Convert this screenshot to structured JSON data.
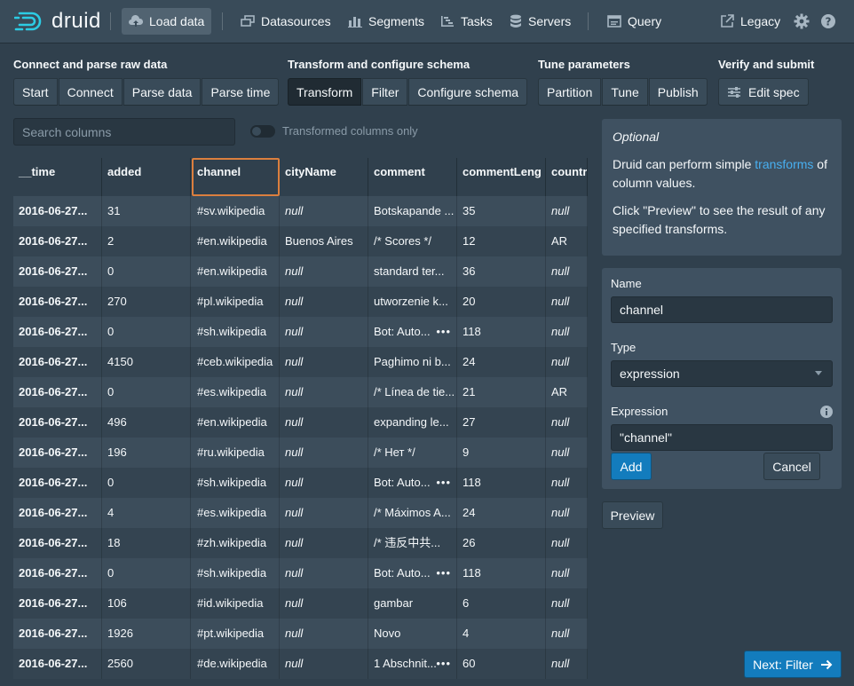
{
  "colors": {
    "accent": "#137cbd",
    "link": "#48aff0",
    "selected_outline": "#db7f3e"
  },
  "header": {
    "logo_text": "druid",
    "nav": [
      {
        "label": "Load data",
        "icon": "cloud-upload-icon"
      },
      {
        "label": "Datasources",
        "icon": "multi-select-icon"
      },
      {
        "label": "Segments",
        "icon": "stacked-chart-icon"
      },
      {
        "label": "Tasks",
        "icon": "gantt-chart-icon"
      },
      {
        "label": "Servers",
        "icon": "database-icon"
      },
      {
        "label": "Query",
        "icon": "application-icon"
      }
    ],
    "legacy_label": "Legacy"
  },
  "steps": [
    {
      "title": "Connect and parse raw data",
      "buttons": [
        "Start",
        "Connect",
        "Parse data",
        "Parse time"
      ]
    },
    {
      "title": "Transform and configure schema",
      "buttons": [
        "Transform",
        "Filter",
        "Configure schema"
      ],
      "active": "Transform"
    },
    {
      "title": "Tune parameters",
      "buttons": [
        "Partition",
        "Tune",
        "Publish"
      ]
    },
    {
      "title": "Verify and submit",
      "buttons": [
        "Edit spec"
      ]
    }
  ],
  "search": {
    "placeholder": "Search columns"
  },
  "toggle": {
    "label": "Transformed columns only"
  },
  "table": {
    "columns": [
      "__time",
      "added",
      "channel",
      "cityName",
      "comment",
      "commentLeng",
      "countr"
    ],
    "selected_column": "channel",
    "rows": [
      [
        "2016-06-27...",
        "31",
        "#sv.wikipedia",
        "null",
        "Botskapande ...",
        "35",
        "null"
      ],
      [
        "2016-06-27...",
        "2",
        "#en.wikipedia",
        "Buenos Aires",
        "/* Scores */",
        "12",
        "AR"
      ],
      [
        "2016-06-27...",
        "0",
        "#en.wikipedia",
        "null",
        "standard ter...",
        "36",
        "null"
      ],
      [
        "2016-06-27...",
        "270",
        "#pl.wikipedia",
        "null",
        "utworzenie k...",
        "20",
        "null"
      ],
      [
        "2016-06-27...",
        "0",
        "#sh.wikipedia",
        "null",
        "Bot: Auto...",
        "118",
        "null"
      ],
      [
        "2016-06-27...",
        "4150",
        "#ceb.wikipedia",
        "null",
        "Paghimo ni b...",
        "24",
        "null"
      ],
      [
        "2016-06-27...",
        "0",
        "#es.wikipedia",
        "null",
        "/* Línea de tie...",
        "21",
        "AR"
      ],
      [
        "2016-06-27...",
        "496",
        "#en.wikipedia",
        "null",
        "expanding le...",
        "27",
        "null"
      ],
      [
        "2016-06-27...",
        "196",
        "#ru.wikipedia",
        "null",
        "/* Нет */",
        "9",
        "null"
      ],
      [
        "2016-06-27...",
        "0",
        "#sh.wikipedia",
        "null",
        "Bot: Auto...",
        "118",
        "null"
      ],
      [
        "2016-06-27...",
        "4",
        "#es.wikipedia",
        "null",
        "/* Máximos A...",
        "24",
        "null"
      ],
      [
        "2016-06-27...",
        "18",
        "#zh.wikipedia",
        "null",
        "/* 违反中共...",
        "26",
        "null"
      ],
      [
        "2016-06-27...",
        "0",
        "#sh.wikipedia",
        "null",
        "Bot: Auto...",
        "118",
        "null"
      ],
      [
        "2016-06-27...",
        "106",
        "#id.wikipedia",
        "null",
        "gambar",
        "6",
        "null"
      ],
      [
        "2016-06-27...",
        "1926",
        "#pt.wikipedia",
        "null",
        "Novo",
        "4",
        "null"
      ],
      [
        "2016-06-27...",
        "2560",
        "#de.wikipedia",
        "null",
        "1 Abschnit...",
        "60",
        "null"
      ]
    ],
    "comment_more_rows": [
      4,
      9,
      12,
      15
    ]
  },
  "info": {
    "optional": "Optional",
    "text_before": "Druid can perform simple ",
    "link": "transforms",
    "text_after": " of column values.",
    "preview_hint": "Click \"Preview\" to see the result of any specified transforms."
  },
  "form": {
    "name_label": "Name",
    "name_value": "channel",
    "type_label": "Type",
    "type_value": "expression",
    "expression_label": "Expression",
    "expression_value": "\"channel\"",
    "add_label": "Add",
    "cancel_label": "Cancel"
  },
  "preview_label": "Preview",
  "next_label": "Next: Filter"
}
